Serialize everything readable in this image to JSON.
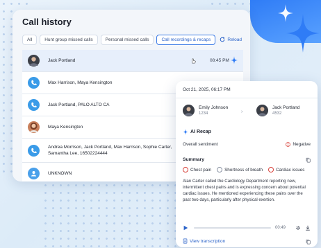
{
  "history": {
    "title": "Call history",
    "tabs": [
      {
        "label": "All",
        "active": false
      },
      {
        "label": "Hunt group missed calls",
        "active": false
      },
      {
        "label": "Personal missed calls",
        "active": false
      },
      {
        "label": "Call recordings & recaps",
        "active": true
      }
    ],
    "reload_label": "Reload",
    "rows": [
      {
        "name": "Jack Portland",
        "time": "08:45 PM",
        "avatar": "person-photo",
        "highlight": true
      },
      {
        "name": "Max Harrison, Maya Kensington",
        "time": "",
        "avatar": "phone-icon",
        "highlight": false
      },
      {
        "name": "Jack Portland, PALO ALTO CA",
        "time": "",
        "avatar": "phone-icon",
        "highlight": false
      },
      {
        "name": "Maya Kensington",
        "time": "",
        "avatar": "person-photo",
        "highlight": false
      },
      {
        "name": "Andrea Morrison, Jack Portland, Max Harrison, Sophie Carter,",
        "name_line2": "Samantha Lee, 16502224444",
        "time": "",
        "avatar": "phone-icon",
        "highlight": false
      },
      {
        "name": "UNKNOWN",
        "time": "",
        "avatar": "user-icon",
        "highlight": false
      }
    ]
  },
  "detail": {
    "date": "Oct 21, 2025, 06:17 PM",
    "from": {
      "name": "Emily Johnson",
      "number": "1234"
    },
    "to": {
      "name": "Jack Portland",
      "number": "4532"
    },
    "recap_label": "AI Recap",
    "sentiment_label": "Overall sentiment",
    "sentiment_value": "Negative",
    "summary_label": "Summary",
    "tags": [
      {
        "label": "Chest pain",
        "color": "red"
      },
      {
        "label": "Shortness of breath",
        "color": "grey"
      },
      {
        "label": "Cardiac issues",
        "color": "red"
      }
    ],
    "summary_text": "Alan Carter called the Cardiology Department reporting new, intermittent chest pains and is expressing concern about potential cardiac issues. He mentioned experiencing these pains over the past two days, particularly after physical exertion.",
    "player": {
      "duration": "00:49"
    },
    "view_transcript_label": "View transcription"
  },
  "colors": {
    "accent": "#2b63c9",
    "negative": "#d8433c",
    "brand_blue": "#2f7cf6"
  }
}
